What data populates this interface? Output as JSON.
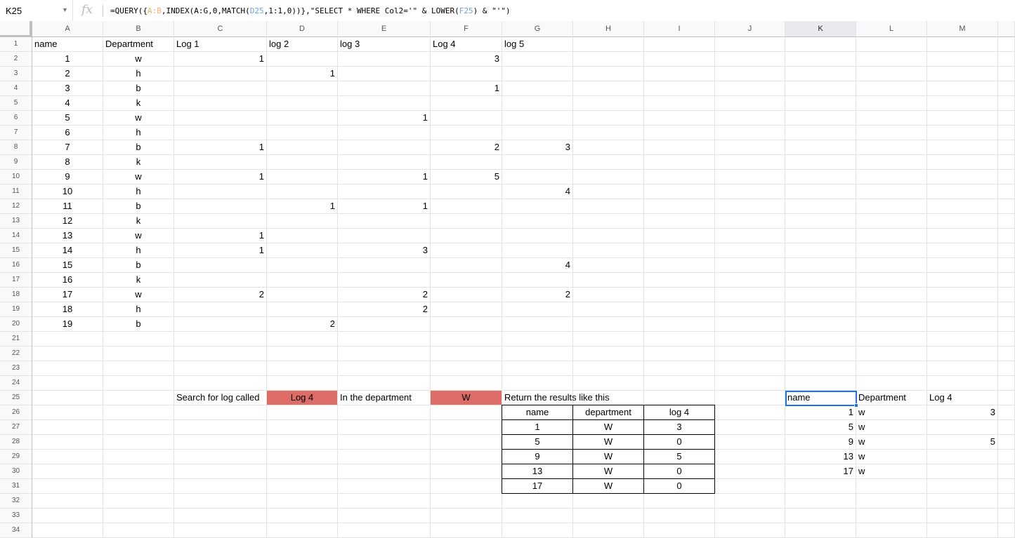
{
  "formula_bar": {
    "name_box": "K25",
    "fx": "fx",
    "formula": [
      {
        "t": "=QUERY({",
        "c": ""
      },
      {
        "t": "A:B",
        "c": "orange"
      },
      {
        "t": ",INDEX(A:G,0,MATCH(",
        "c": ""
      },
      {
        "t": "D25",
        "c": "blue"
      },
      {
        "t": ",1:1,0))},\"SELECT * WHERE Col2='\" & LOWER(",
        "c": ""
      },
      {
        "t": "F25",
        "c": "blue"
      },
      {
        "t": ") & \"'\")",
        "c": ""
      }
    ]
  },
  "columns": [
    "A",
    "B",
    "C",
    "D",
    "E",
    "F",
    "G",
    "H",
    "I",
    "J",
    "K",
    "L",
    "M"
  ],
  "selected_column": "K",
  "rows": [
    "1",
    "2",
    "3",
    "4",
    "5",
    "6",
    "7",
    "8",
    "9",
    "10",
    "11",
    "12",
    "13",
    "14",
    "15",
    "16",
    "17",
    "18",
    "19",
    "20",
    "21",
    "22",
    "23",
    "24",
    "25",
    "26",
    "27",
    "28",
    "29",
    "30",
    "31",
    "32",
    "33",
    "34"
  ],
  "cells": [
    {
      "r": 1,
      "c": "A",
      "v": "name",
      "a": "l"
    },
    {
      "r": 1,
      "c": "B",
      "v": "Department",
      "a": "l"
    },
    {
      "r": 1,
      "c": "C",
      "v": "Log 1",
      "a": "l"
    },
    {
      "r": 1,
      "c": "D",
      "v": "log 2",
      "a": "l"
    },
    {
      "r": 1,
      "c": "E",
      "v": "log 3",
      "a": "l"
    },
    {
      "r": 1,
      "c": "F",
      "v": "Log 4",
      "a": "l"
    },
    {
      "r": 1,
      "c": "G",
      "v": "log 5",
      "a": "l"
    },
    {
      "r": 2,
      "c": "A",
      "v": "1",
      "a": "c"
    },
    {
      "r": 2,
      "c": "B",
      "v": "w",
      "a": "c"
    },
    {
      "r": 2,
      "c": "C",
      "v": "1",
      "a": "r"
    },
    {
      "r": 2,
      "c": "F",
      "v": "3",
      "a": "r"
    },
    {
      "r": 3,
      "c": "A",
      "v": "2",
      "a": "c"
    },
    {
      "r": 3,
      "c": "B",
      "v": "h",
      "a": "c"
    },
    {
      "r": 3,
      "c": "D",
      "v": "1",
      "a": "r"
    },
    {
      "r": 4,
      "c": "A",
      "v": "3",
      "a": "c"
    },
    {
      "r": 4,
      "c": "B",
      "v": "b",
      "a": "c"
    },
    {
      "r": 4,
      "c": "F",
      "v": "1",
      "a": "r"
    },
    {
      "r": 5,
      "c": "A",
      "v": "4",
      "a": "c"
    },
    {
      "r": 5,
      "c": "B",
      "v": "k",
      "a": "c"
    },
    {
      "r": 6,
      "c": "A",
      "v": "5",
      "a": "c"
    },
    {
      "r": 6,
      "c": "B",
      "v": "w",
      "a": "c"
    },
    {
      "r": 6,
      "c": "E",
      "v": "1",
      "a": "r"
    },
    {
      "r": 7,
      "c": "A",
      "v": "6",
      "a": "c"
    },
    {
      "r": 7,
      "c": "B",
      "v": "h",
      "a": "c"
    },
    {
      "r": 8,
      "c": "A",
      "v": "7",
      "a": "c"
    },
    {
      "r": 8,
      "c": "B",
      "v": "b",
      "a": "c"
    },
    {
      "r": 8,
      "c": "C",
      "v": "1",
      "a": "r"
    },
    {
      "r": 8,
      "c": "F",
      "v": "2",
      "a": "r"
    },
    {
      "r": 8,
      "c": "G",
      "v": "3",
      "a": "r"
    },
    {
      "r": 9,
      "c": "A",
      "v": "8",
      "a": "c"
    },
    {
      "r": 9,
      "c": "B",
      "v": "k",
      "a": "c"
    },
    {
      "r": 10,
      "c": "A",
      "v": "9",
      "a": "c"
    },
    {
      "r": 10,
      "c": "B",
      "v": "w",
      "a": "c"
    },
    {
      "r": 10,
      "c": "C",
      "v": "1",
      "a": "r"
    },
    {
      "r": 10,
      "c": "E",
      "v": "1",
      "a": "r"
    },
    {
      "r": 10,
      "c": "F",
      "v": "5",
      "a": "r"
    },
    {
      "r": 11,
      "c": "A",
      "v": "10",
      "a": "c"
    },
    {
      "r": 11,
      "c": "B",
      "v": "h",
      "a": "c"
    },
    {
      "r": 11,
      "c": "G",
      "v": "4",
      "a": "r"
    },
    {
      "r": 12,
      "c": "A",
      "v": "11",
      "a": "c"
    },
    {
      "r": 12,
      "c": "B",
      "v": "b",
      "a": "c"
    },
    {
      "r": 12,
      "c": "D",
      "v": "1",
      "a": "r"
    },
    {
      "r": 12,
      "c": "E",
      "v": "1",
      "a": "r"
    },
    {
      "r": 13,
      "c": "A",
      "v": "12",
      "a": "c"
    },
    {
      "r": 13,
      "c": "B",
      "v": "k",
      "a": "c"
    },
    {
      "r": 14,
      "c": "A",
      "v": "13",
      "a": "c"
    },
    {
      "r": 14,
      "c": "B",
      "v": "w",
      "a": "c"
    },
    {
      "r": 14,
      "c": "C",
      "v": "1",
      "a": "r"
    },
    {
      "r": 15,
      "c": "A",
      "v": "14",
      "a": "c"
    },
    {
      "r": 15,
      "c": "B",
      "v": "h",
      "a": "c"
    },
    {
      "r": 15,
      "c": "C",
      "v": "1",
      "a": "r"
    },
    {
      "r": 15,
      "c": "E",
      "v": "3",
      "a": "r"
    },
    {
      "r": 16,
      "c": "A",
      "v": "15",
      "a": "c"
    },
    {
      "r": 16,
      "c": "B",
      "v": "b",
      "a": "c"
    },
    {
      "r": 16,
      "c": "G",
      "v": "4",
      "a": "r"
    },
    {
      "r": 17,
      "c": "A",
      "v": "16",
      "a": "c"
    },
    {
      "r": 17,
      "c": "B",
      "v": "k",
      "a": "c"
    },
    {
      "r": 18,
      "c": "A",
      "v": "17",
      "a": "c"
    },
    {
      "r": 18,
      "c": "B",
      "v": "w",
      "a": "c"
    },
    {
      "r": 18,
      "c": "C",
      "v": "2",
      "a": "r"
    },
    {
      "r": 18,
      "c": "E",
      "v": "2",
      "a": "r"
    },
    {
      "r": 18,
      "c": "G",
      "v": "2",
      "a": "r"
    },
    {
      "r": 19,
      "c": "A",
      "v": "18",
      "a": "c"
    },
    {
      "r": 19,
      "c": "B",
      "v": "h",
      "a": "c"
    },
    {
      "r": 19,
      "c": "E",
      "v": "2",
      "a": "r"
    },
    {
      "r": 20,
      "c": "A",
      "v": "19",
      "a": "c"
    },
    {
      "r": 20,
      "c": "B",
      "v": "b",
      "a": "c"
    },
    {
      "r": 20,
      "c": "D",
      "v": "2",
      "a": "r"
    },
    {
      "r": 25,
      "c": "C",
      "v": "Search for log called",
      "a": "l"
    },
    {
      "r": 25,
      "c": "D",
      "v": "Log 4",
      "a": "c",
      "bg": "red"
    },
    {
      "r": 25,
      "c": "E",
      "v": "In the  department",
      "a": "l"
    },
    {
      "r": 25,
      "c": "F",
      "v": "W",
      "a": "c",
      "bg": "red"
    },
    {
      "r": 25,
      "c": "G",
      "v": "Return the results like this",
      "a": "l"
    },
    {
      "r": 26,
      "c": "G",
      "v": "name",
      "a": "c",
      "b": 1
    },
    {
      "r": 26,
      "c": "H",
      "v": "department",
      "a": "c",
      "b": 1
    },
    {
      "r": 26,
      "c": "I",
      "v": "log 4",
      "a": "c",
      "b": 1
    },
    {
      "r": 27,
      "c": "G",
      "v": "1",
      "a": "c",
      "b": 1
    },
    {
      "r": 27,
      "c": "H",
      "v": "W",
      "a": "c",
      "b": 1
    },
    {
      "r": 27,
      "c": "I",
      "v": "3",
      "a": "c",
      "b": 1
    },
    {
      "r": 28,
      "c": "G",
      "v": "5",
      "a": "c",
      "b": 1
    },
    {
      "r": 28,
      "c": "H",
      "v": "W",
      "a": "c",
      "b": 1
    },
    {
      "r": 28,
      "c": "I",
      "v": "0",
      "a": "c",
      "b": 1
    },
    {
      "r": 29,
      "c": "G",
      "v": "9",
      "a": "c",
      "b": 1
    },
    {
      "r": 29,
      "c": "H",
      "v": "W",
      "a": "c",
      "b": 1
    },
    {
      "r": 29,
      "c": "I",
      "v": "5",
      "a": "c",
      "b": 1
    },
    {
      "r": 30,
      "c": "G",
      "v": "13",
      "a": "c",
      "b": 1
    },
    {
      "r": 30,
      "c": "H",
      "v": "W",
      "a": "c",
      "b": 1
    },
    {
      "r": 30,
      "c": "I",
      "v": "0",
      "a": "c",
      "b": 1
    },
    {
      "r": 31,
      "c": "G",
      "v": "17",
      "a": "c",
      "b": 1
    },
    {
      "r": 31,
      "c": "H",
      "v": "W",
      "a": "c",
      "b": 1
    },
    {
      "r": 31,
      "c": "I",
      "v": "0",
      "a": "c",
      "b": 1
    },
    {
      "r": 25,
      "c": "K",
      "v": "name",
      "a": "l"
    },
    {
      "r": 25,
      "c": "L",
      "v": "Department",
      "a": "l"
    },
    {
      "r": 25,
      "c": "M",
      "v": "Log 4",
      "a": "l"
    },
    {
      "r": 26,
      "c": "K",
      "v": "1",
      "a": "r"
    },
    {
      "r": 26,
      "c": "L",
      "v": "w",
      "a": "l"
    },
    {
      "r": 26,
      "c": "M",
      "v": "3",
      "a": "r"
    },
    {
      "r": 27,
      "c": "K",
      "v": "5",
      "a": "r"
    },
    {
      "r": 27,
      "c": "L",
      "v": "w",
      "a": "l"
    },
    {
      "r": 28,
      "c": "K",
      "v": "9",
      "a": "r"
    },
    {
      "r": 28,
      "c": "L",
      "v": "w",
      "a": "l"
    },
    {
      "r": 28,
      "c": "M",
      "v": "5",
      "a": "r"
    },
    {
      "r": 29,
      "c": "K",
      "v": "13",
      "a": "r"
    },
    {
      "r": 29,
      "c": "L",
      "v": "w",
      "a": "l"
    },
    {
      "r": 30,
      "c": "K",
      "v": "17",
      "a": "r"
    },
    {
      "r": 30,
      "c": "L",
      "v": "w",
      "a": "l"
    }
  ],
  "selected_cell": "K25",
  "colors": {
    "highlight_red": "#dd6b66",
    "selection_blue": "#1a73e8",
    "ref_blue": "#6d9eeb",
    "ref_orange": "#f6b26b"
  }
}
